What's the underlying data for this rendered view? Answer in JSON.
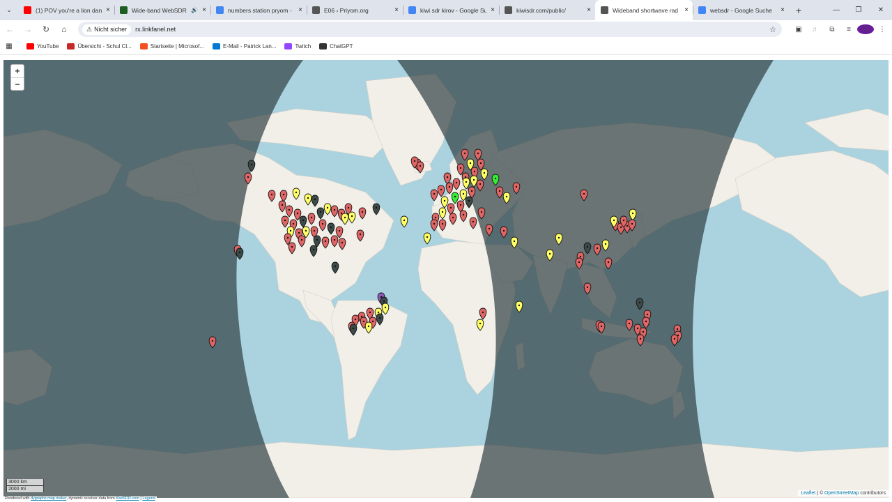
{
  "tabs": [
    {
      "title": "(1) POV you're a lion dan",
      "favicon": "youtube-icon",
      "color": "#ff0000",
      "close": "×"
    },
    {
      "title": "Wide-band WebSDR",
      "favicon": "websdr-icon",
      "color": "#1b5e20",
      "close": "×",
      "audio": "🔊"
    },
    {
      "title": "numbers station pryom -",
      "favicon": "google-icon",
      "color": "#4285f4",
      "close": "×"
    },
    {
      "title": "E06 › Priyom.org",
      "favicon": "priyom-icon",
      "color": "#555555",
      "close": "×"
    },
    {
      "title": "kiwi sdr kirov - Google Su",
      "favicon": "google-icon",
      "color": "#4285f4",
      "close": "×"
    },
    {
      "title": "kiwisdr.com/public/",
      "favicon": "kiwi-icon",
      "color": "#555555",
      "close": "×"
    },
    {
      "title": "Wideband shortwave rad",
      "favicon": "radio-icon",
      "color": "#555555",
      "close": "×"
    },
    {
      "title": "websdr - Google Suche",
      "favicon": "google-icon",
      "color": "#4285f4",
      "close": "×"
    }
  ],
  "new_tab": "+",
  "window": {
    "minimize": "—",
    "restore": "❐",
    "close": "✕"
  },
  "address": {
    "security": "Nicht sicher",
    "url": "rx.linkfanel.net"
  },
  "bookmarks": [
    {
      "label": "YouTube",
      "icon": "youtube-icon",
      "color": "#ff0000"
    },
    {
      "label": "Übersicht - Schul Cl...",
      "icon": "school-icon",
      "color": "#c62828"
    },
    {
      "label": "Startseite | Microsof...",
      "icon": "microsoft-icon",
      "color": "#f25022"
    },
    {
      "label": "E-Mail - Patrick Lan...",
      "icon": "outlook-icon",
      "color": "#0078d4"
    },
    {
      "label": "Twitch",
      "icon": "twitch-icon",
      "color": "#9146ff"
    },
    {
      "label": "ChatGPT",
      "icon": "chatgpt-icon",
      "color": "#333333"
    }
  ],
  "map": {
    "zoom_in": "+",
    "zoom_out": "−",
    "scale_km": "3000 km",
    "scale_mi": "2000 mi",
    "attribution_leaflet": "Leaflet",
    "attribution_sep": " | © ",
    "attribution_osm": "OpenStreetMap",
    "attribution_rest": " contributors",
    "colors": {
      "ocean": "#aad3df",
      "land": "#f2efe9",
      "night": "#2b3a3c",
      "marker_red": "#e06666",
      "marker_yellow": "#ffff66",
      "marker_green": "#33ee33",
      "marker_dark": "#3c4a48",
      "marker_purple": "#8e5bb5"
    }
  },
  "footer": {
    "prefix": "Rendered with ",
    "link1": "dygraphs map maker",
    "mid": ", dynamic receiver data from ",
    "link2": "KiwiSDR.com",
    "sep": " | ",
    "link3": "Legend"
  }
}
